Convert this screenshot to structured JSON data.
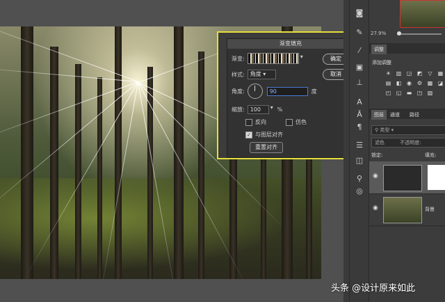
{
  "dialog": {
    "title": "渐变填充",
    "gradient_label": "渐变:",
    "style_label": "样式:",
    "style_value": "角度",
    "angle_label": "角度:",
    "angle_value": "90",
    "angle_unit": "度",
    "scale_label": "缩放:",
    "scale_value": "100",
    "scale_unit": "%",
    "reverse_label": "反向",
    "dither_label": "仿色",
    "align_label": "与图层对齐",
    "reset_align_label": "重置对齐",
    "ok_label": "确定",
    "cancel_label": "取消",
    "highlight_color": "#e6df3d"
  },
  "panel": {
    "zoom": "27.9%",
    "adjustments_tab": "调整",
    "add_adjustment": "添加调整",
    "tabs": [
      "图层",
      "通道",
      "路径"
    ],
    "kind_label": "类型",
    "blend_mode": "滤色",
    "opacity_label": "不透明度:",
    "lock_label": "锁定:",
    "fill_label": "填充:",
    "layers": [
      {
        "name": "",
        "selected": true,
        "type": "gradient-fill"
      },
      {
        "name": "背景",
        "selected": false,
        "type": "image"
      }
    ]
  },
  "watermark": "头条 @设计原来如此"
}
